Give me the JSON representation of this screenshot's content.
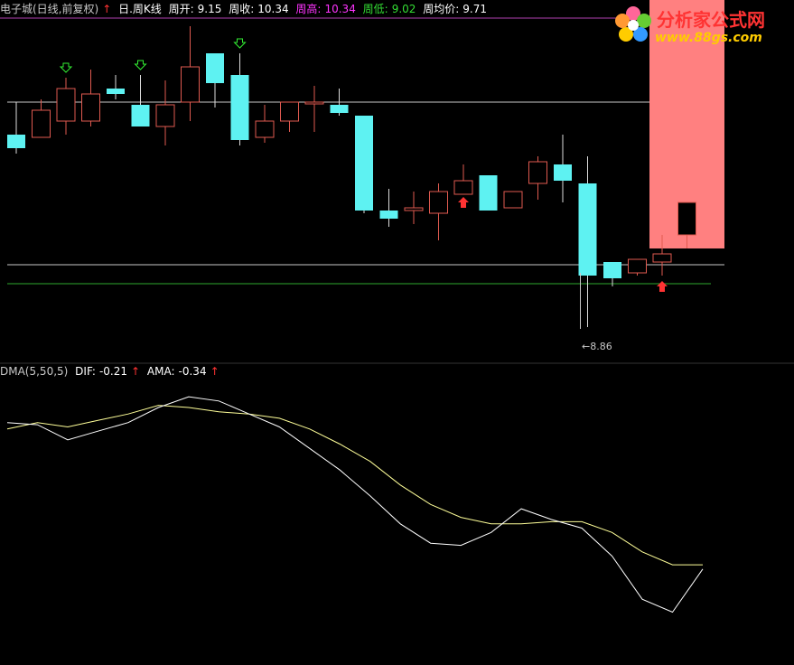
{
  "header": {
    "title": "电子城(日线,前复权)",
    "title_arrow": "↑",
    "overlay_name": "日.周K线",
    "open_label": "周开:",
    "open_value": "9.15",
    "close_label": "周收:",
    "close_value": "10.34",
    "high_label": "周高:",
    "high_value": "10.34",
    "low_label": "周低:",
    "low_value": "9.02",
    "avg_label": "周均价:",
    "avg_value": "9.71"
  },
  "low_marker": "8.86",
  "oscillator": {
    "name": "DMA(5,50,5)",
    "dif_label": "DIF:",
    "dif_value": "-0.21",
    "dif_arrow": "↑",
    "ama_label": "AMA:",
    "ama_value": "-0.34",
    "ama_arrow": "↑"
  },
  "logo": {
    "brand": "分析家公式网",
    "url": "www.88gs.com"
  },
  "colors": {
    "up_candle": "#e05a50",
    "down_candle": "#5ef2f2",
    "weekly_bar": "#ff8080",
    "grid": "#c8c8c8",
    "support_line": "#2ea82e",
    "dif_line": "#ffffff",
    "ama_line": "#ffff99"
  },
  "chart_data": {
    "type": "candlestick",
    "candles": [
      {
        "o": 9.57,
        "h": 9.69,
        "l": 9.5,
        "c": 9.52
      },
      {
        "o": 9.56,
        "h": 9.7,
        "l": 9.56,
        "c": 9.66
      },
      {
        "o": 9.62,
        "h": 9.78,
        "l": 9.57,
        "c": 9.74
      },
      {
        "o": 9.62,
        "h": 9.81,
        "l": 9.6,
        "c": 9.72
      },
      {
        "o": 9.74,
        "h": 9.79,
        "l": 9.7,
        "c": 9.72
      },
      {
        "o": 9.68,
        "h": 9.79,
        "l": 9.6,
        "c": 9.6
      },
      {
        "o": 9.6,
        "h": 9.77,
        "l": 9.53,
        "c": 9.68
      },
      {
        "o": 9.69,
        "h": 9.97,
        "l": 9.62,
        "c": 9.82
      },
      {
        "o": 9.87,
        "h": 9.87,
        "l": 9.67,
        "c": 9.76
      },
      {
        "o": 9.79,
        "h": 9.87,
        "l": 9.53,
        "c": 9.55
      },
      {
        "o": 9.56,
        "h": 9.68,
        "l": 9.54,
        "c": 9.62
      },
      {
        "o": 9.62,
        "h": 9.68,
        "l": 9.58,
        "c": 9.69
      },
      {
        "o": 9.69,
        "h": 9.75,
        "l": 9.58,
        "c": 9.69
      },
      {
        "o": 9.68,
        "h": 9.74,
        "l": 9.64,
        "c": 9.65
      },
      {
        "o": 9.64,
        "h": 9.64,
        "l": 9.28,
        "c": 9.29
      },
      {
        "o": 9.29,
        "h": 9.37,
        "l": 9.23,
        "c": 9.26
      },
      {
        "o": 9.29,
        "h": 9.36,
        "l": 9.24,
        "c": 9.3
      },
      {
        "o": 9.28,
        "h": 9.39,
        "l": 9.18,
        "c": 9.36
      },
      {
        "o": 9.35,
        "h": 9.46,
        "l": 9.36,
        "c": 9.4
      },
      {
        "o": 9.42,
        "h": 9.42,
        "l": 9.29,
        "c": 9.29
      },
      {
        "o": 9.3,
        "h": 9.36,
        "l": 9.3,
        "c": 9.36
      },
      {
        "o": 9.39,
        "h": 9.49,
        "l": 9.33,
        "c": 9.47
      },
      {
        "o": 9.46,
        "h": 9.57,
        "l": 9.32,
        "c": 9.4
      },
      {
        "o": 9.39,
        "h": 9.49,
        "l": 8.86,
        "c": 9.05
      },
      {
        "o": 9.1,
        "h": 9.1,
        "l": 9.01,
        "c": 9.04
      },
      {
        "o": 9.06,
        "h": 9.11,
        "l": 9.05,
        "c": 9.11
      },
      {
        "o": 9.1,
        "h": 9.2,
        "l": 9.05,
        "c": 9.13
      },
      {
        "o": 9.2,
        "h": 9.32,
        "l": 9.15,
        "c": 9.32
      }
    ],
    "down_arrows_at": [
      2,
      5,
      9
    ],
    "up_arrows_at": [
      18,
      26
    ],
    "weekly_bar": {
      "low": 9.15,
      "high": 10.34,
      "from_index": 26,
      "to_index": 28
    },
    "horizontal_levels": [
      9.69,
      9.09,
      9.02
    ],
    "price_range": [
      8.75,
      10.0
    ],
    "oscillator_range": [
      -0.9,
      0.4
    ],
    "dif": [
      0.2,
      0.19,
      0.12,
      0.16,
      0.2,
      0.27,
      0.32,
      0.3,
      0.24,
      0.18,
      0.08,
      -0.02,
      -0.14,
      -0.27,
      -0.36,
      -0.37,
      -0.31,
      -0.2,
      -0.25,
      -0.29,
      -0.42,
      -0.62,
      -0.68,
      -0.48
    ],
    "ama": [
      0.17,
      0.2,
      0.18,
      0.21,
      0.24,
      0.28,
      0.27,
      0.25,
      0.24,
      0.22,
      0.17,
      0.1,
      0.02,
      -0.09,
      -0.18,
      -0.24,
      -0.27,
      -0.27,
      -0.26,
      -0.26,
      -0.31,
      -0.4,
      -0.46,
      -0.46
    ]
  }
}
